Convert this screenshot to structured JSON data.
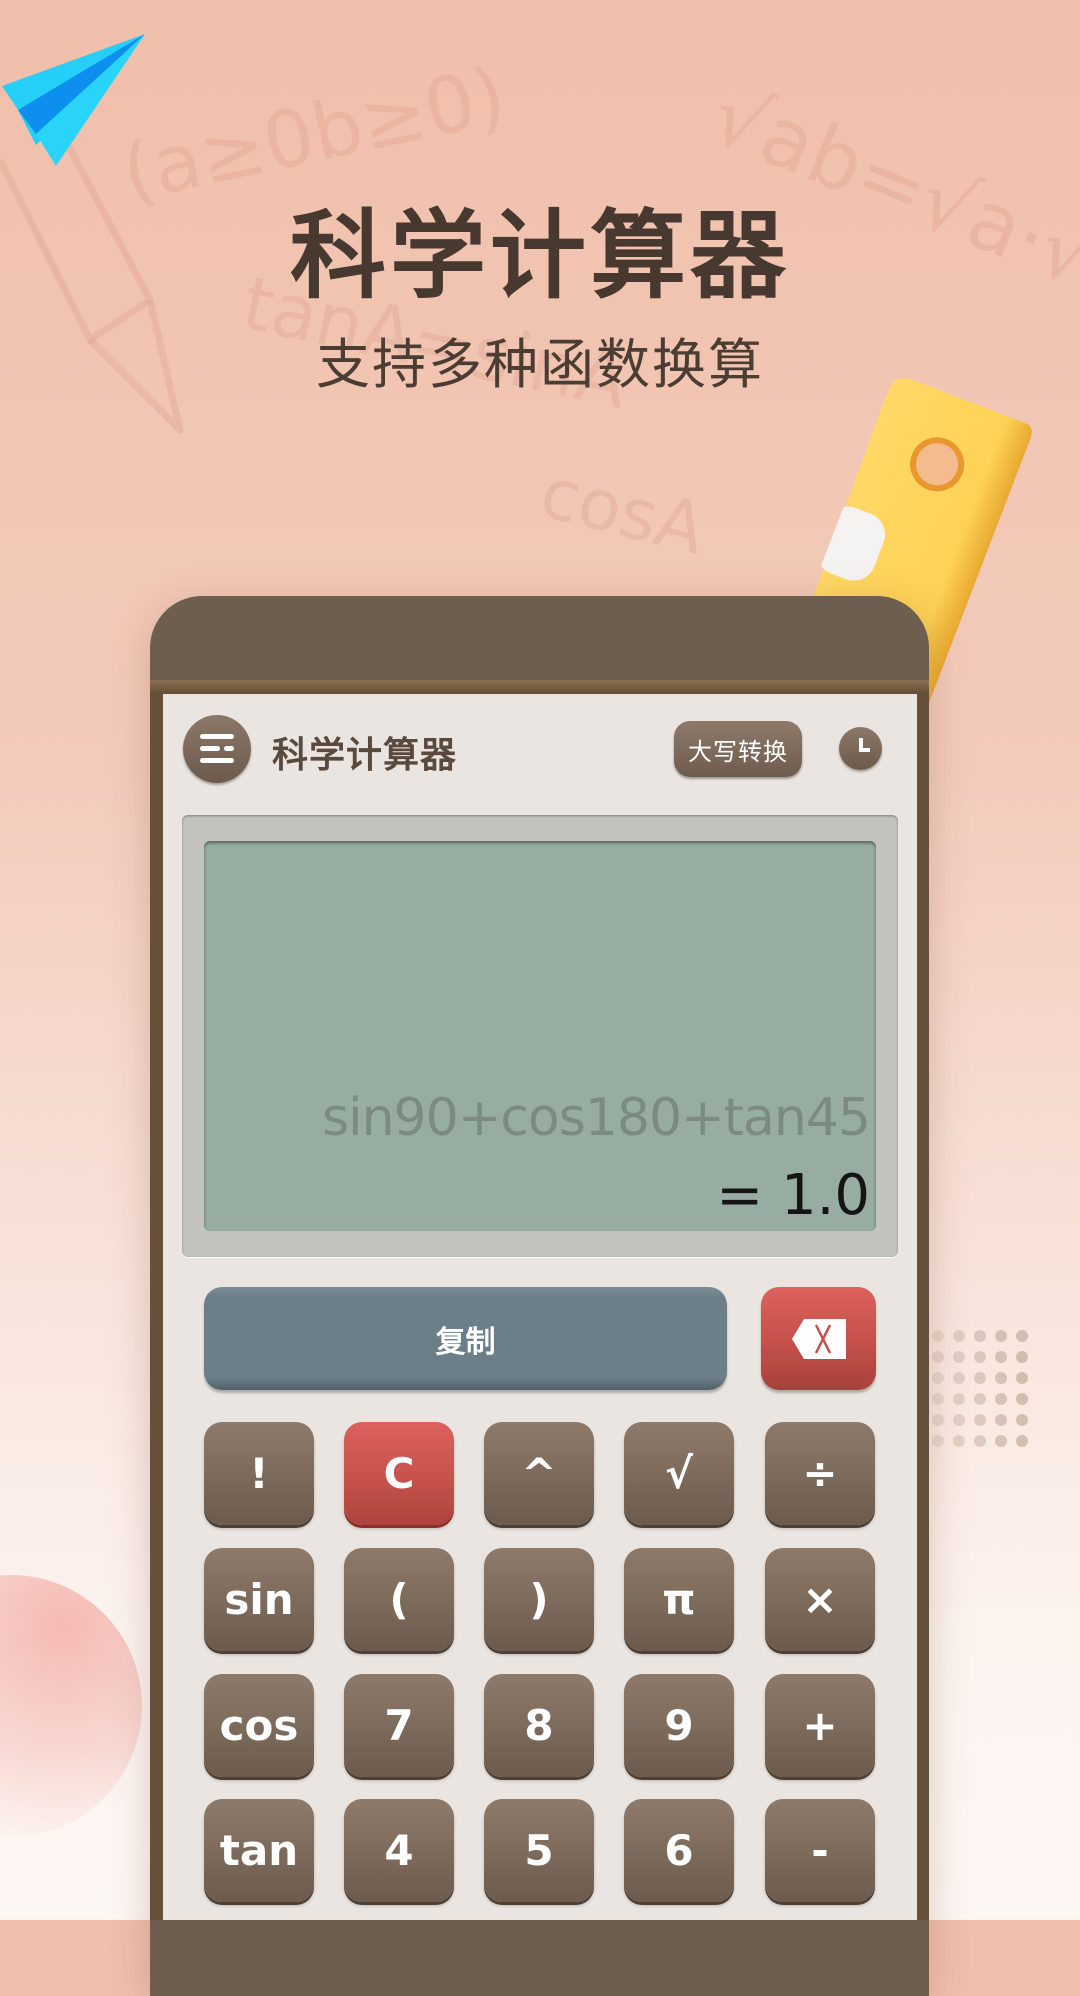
{
  "promo": {
    "headline": "科学计算器",
    "subheadline": "支持多种函数换算"
  },
  "background_formulas": {
    "f1": "(a≥0b≥0)",
    "f2": "√ab=√a·√b",
    "f3": "tanA=sinA",
    "f4": "cosA"
  },
  "app": {
    "title": "科学计算器",
    "menu_icon": "menu-icon",
    "convert_label": "大写转换",
    "history_icon": "clock-icon"
  },
  "display": {
    "expression": "sin90+cos180+tan45",
    "result": "= 1.0"
  },
  "actions": {
    "copy_label": "复制",
    "backspace_icon": "backspace-icon"
  },
  "keypad": {
    "rows": [
      [
        {
          "label": "!",
          "style": "normal"
        },
        {
          "label": "C",
          "style": "red"
        },
        {
          "label": "^",
          "style": "normal"
        },
        {
          "label": "√",
          "style": "normal"
        },
        {
          "label": "÷",
          "style": "normal"
        }
      ],
      [
        {
          "label": "sin",
          "style": "normal"
        },
        {
          "label": "(",
          "style": "normal"
        },
        {
          "label": ")",
          "style": "normal"
        },
        {
          "label": "π",
          "style": "normal"
        },
        {
          "label": "×",
          "style": "normal"
        }
      ],
      [
        {
          "label": "cos",
          "style": "normal"
        },
        {
          "label": "7",
          "style": "normal"
        },
        {
          "label": "8",
          "style": "normal"
        },
        {
          "label": "9",
          "style": "normal"
        },
        {
          "label": "+",
          "style": "normal"
        }
      ],
      [
        {
          "label": "tan",
          "style": "normal"
        },
        {
          "label": "4",
          "style": "normal"
        },
        {
          "label": "5",
          "style": "normal"
        },
        {
          "label": "6",
          "style": "normal"
        },
        {
          "label": "-",
          "style": "normal"
        }
      ]
    ]
  },
  "colors": {
    "key_brown": "#7d6b5c",
    "key_red": "#c7524c",
    "copy_slate": "#6c7f88",
    "lcd_green": "#97ada2",
    "frame_brown": "#6d5e4f"
  }
}
